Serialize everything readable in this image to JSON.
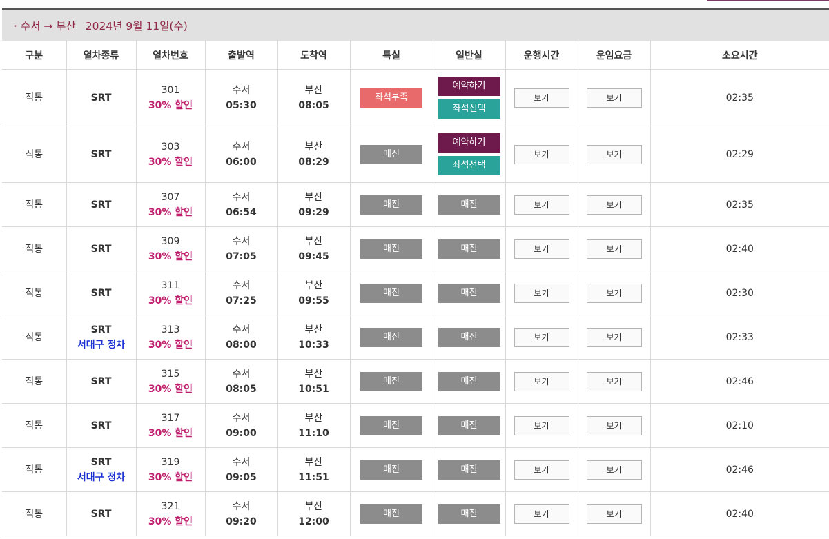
{
  "route": {
    "title": "· 수서 → 부산",
    "date": "2024년 9월 11일(수)"
  },
  "headers": [
    "구분",
    "열차종류",
    "열차번호",
    "출발역",
    "도착역",
    "특실",
    "일반실",
    "운행시간",
    "운임요금",
    "소요시간"
  ],
  "rows": [
    {
      "type": "직통",
      "train": "SRT",
      "stop": "",
      "no": "301",
      "discount": "30% 할인",
      "dep_st": "수서",
      "dep_t": "05:30",
      "arr_st": "부산",
      "arr_t": "08:05",
      "first": "좌석부족",
      "general": "예약하기",
      "general2": "좌석선택",
      "op": "보기",
      "fare": "보기",
      "dur": "02:35"
    },
    {
      "type": "직통",
      "train": "SRT",
      "stop": "",
      "no": "303",
      "discount": "30% 할인",
      "dep_st": "수서",
      "dep_t": "06:00",
      "arr_st": "부산",
      "arr_t": "08:29",
      "first": "매진",
      "general": "예약하기",
      "general2": "좌석선택",
      "op": "보기",
      "fare": "보기",
      "dur": "02:29"
    },
    {
      "type": "직통",
      "train": "SRT",
      "stop": "",
      "no": "307",
      "discount": "30% 할인",
      "dep_st": "수서",
      "dep_t": "06:54",
      "arr_st": "부산",
      "arr_t": "09:29",
      "first": "매진",
      "general": "매진",
      "op": "보기",
      "fare": "보기",
      "dur": "02:35"
    },
    {
      "type": "직통",
      "train": "SRT",
      "stop": "",
      "no": "309",
      "discount": "30% 할인",
      "dep_st": "수서",
      "dep_t": "07:05",
      "arr_st": "부산",
      "arr_t": "09:45",
      "first": "매진",
      "general": "매진",
      "op": "보기",
      "fare": "보기",
      "dur": "02:40"
    },
    {
      "type": "직통",
      "train": "SRT",
      "stop": "",
      "no": "311",
      "discount": "30% 할인",
      "dep_st": "수서",
      "dep_t": "07:25",
      "arr_st": "부산",
      "arr_t": "09:55",
      "first": "매진",
      "general": "매진",
      "op": "보기",
      "fare": "보기",
      "dur": "02:30"
    },
    {
      "type": "직통",
      "train": "SRT",
      "stop": "서대구 정차",
      "no": "313",
      "discount": "30% 할인",
      "dep_st": "수서",
      "dep_t": "08:00",
      "arr_st": "부산",
      "arr_t": "10:33",
      "first": "매진",
      "general": "매진",
      "op": "보기",
      "fare": "보기",
      "dur": "02:33"
    },
    {
      "type": "직통",
      "train": "SRT",
      "stop": "",
      "no": "315",
      "discount": "30% 할인",
      "dep_st": "수서",
      "dep_t": "08:05",
      "arr_st": "부산",
      "arr_t": "10:51",
      "first": "매진",
      "general": "매진",
      "op": "보기",
      "fare": "보기",
      "dur": "02:46"
    },
    {
      "type": "직통",
      "train": "SRT",
      "stop": "",
      "no": "317",
      "discount": "30% 할인",
      "dep_st": "수서",
      "dep_t": "09:00",
      "arr_st": "부산",
      "arr_t": "11:10",
      "first": "매진",
      "general": "매진",
      "op": "보기",
      "fare": "보기",
      "dur": "02:10"
    },
    {
      "type": "직통",
      "train": "SRT",
      "stop": "서대구 정차",
      "no": "319",
      "discount": "30% 할인",
      "dep_st": "수서",
      "dep_t": "09:05",
      "arr_st": "부산",
      "arr_t": "11:51",
      "first": "매진",
      "general": "매진",
      "op": "보기",
      "fare": "보기",
      "dur": "02:46"
    },
    {
      "type": "직통",
      "train": "SRT",
      "stop": "",
      "no": "321",
      "discount": "30% 할인",
      "dep_st": "수서",
      "dep_t": "09:20",
      "arr_st": "부산",
      "arr_t": "12:00",
      "first": "매진",
      "general": "매진",
      "op": "보기",
      "fare": "보기",
      "dur": "02:40"
    }
  ],
  "colors": {
    "accent": "#8f2746",
    "discount": "#c01f6d",
    "stop": "#1a2fd3",
    "soldout": "#8c8c8c",
    "lack": "#e86a6a",
    "reserve": "#6f1a4c",
    "seat": "#2aa39a"
  }
}
